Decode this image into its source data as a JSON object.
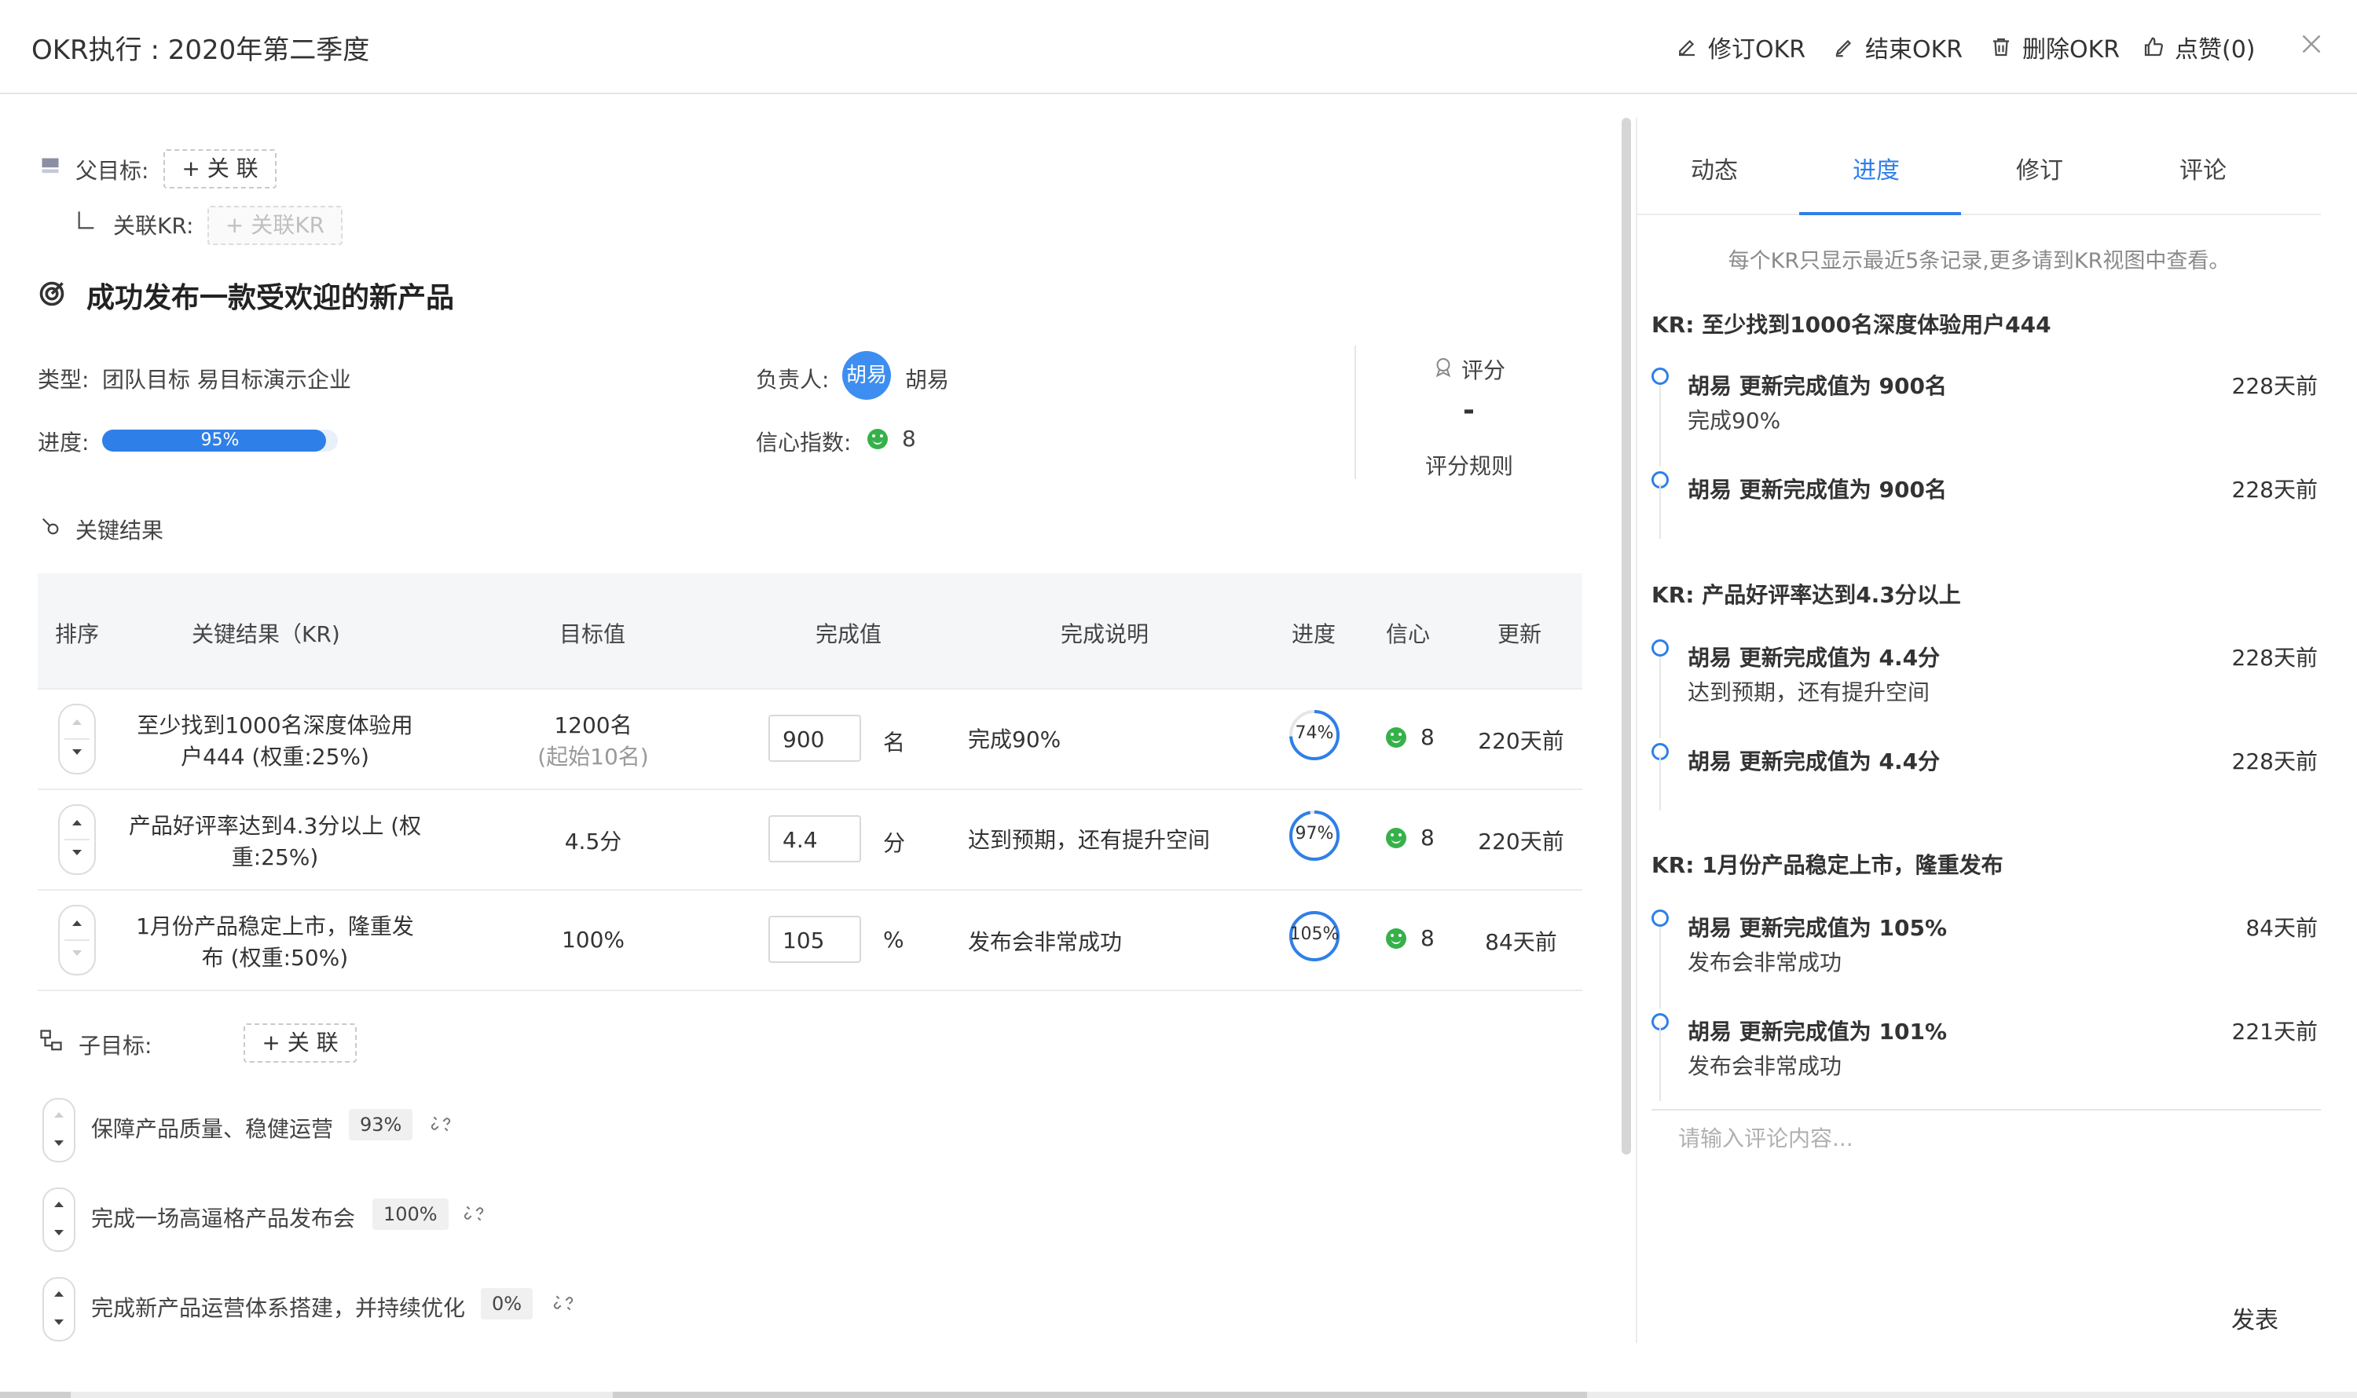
{
  "header": {
    "title": "OKR执行 : 2020年第二季度",
    "revise": "修订OKR",
    "finish": "结束OKR",
    "delete": "删除OKR",
    "like": "点赞(0)"
  },
  "parent": {
    "label": "父目标:",
    "link_btn": "+ 关 联",
    "kr_label": "关联KR:",
    "kr_btn": "+ 关联KR"
  },
  "objective": {
    "title": "成功发布一款受欢迎的新产品",
    "type_label": "类型:",
    "type_value": "团队目标 易目标演示企业",
    "owner_label": "负责人:",
    "owner_avatar": "胡易",
    "owner_name": "胡易",
    "progress_label": "进度:",
    "progress": 95,
    "progress_text": "95%",
    "confidence_label": "信心指数:",
    "confidence": "8",
    "score_title": "评分",
    "score_value": "-",
    "score_rule": "评分规则"
  },
  "kr_section": {
    "title": "关键结果",
    "headers": [
      "排序",
      "关键结果（KR)",
      "目标值",
      "完成值",
      "完成说明",
      "进度",
      "信心",
      "更新"
    ],
    "rows": [
      {
        "name1": "至少找到1000名深度体验用",
        "name2": "户444 (权重:25%)",
        "target": "1200名",
        "target_sub": "(起始10名)",
        "done": "900",
        "unit": "名",
        "desc": "完成90%",
        "progress": 74,
        "progress_text": "74%",
        "confidence": "8",
        "updated": "220天前"
      },
      {
        "name1": "产品好评率达到4.3分以上 (权",
        "name2": "重:25%)",
        "target": "4.5分",
        "target_sub": "",
        "done": "4.4",
        "unit": "分",
        "desc": "达到预期，还有提升空间",
        "progress": 97,
        "progress_text": "97%",
        "confidence": "8",
        "updated": "220天前"
      },
      {
        "name1": "1月份产品稳定上市，隆重发",
        "name2": "布 (权重:50%)",
        "target": "100%",
        "target_sub": "",
        "done": "105",
        "unit": "%",
        "desc": "发布会非常成功",
        "progress": 105,
        "progress_text": "105%",
        "confidence": "8",
        "updated": "84天前"
      }
    ]
  },
  "children": {
    "label": "子目标:",
    "link_btn": "+ 关 联",
    "items": [
      {
        "name": "保障产品质量、稳健运营",
        "badge": "93%"
      },
      {
        "name": "完成一场高逼格产品发布会",
        "badge": "100%"
      },
      {
        "name": "完成新产品运营体系搭建，并持续优化",
        "badge": "0%"
      }
    ]
  },
  "panel": {
    "tabs": [
      "动态",
      "进度",
      "修订",
      "评论"
    ],
    "hint": "每个KR只显示最近5条记录,更多请到KR视图中查看。",
    "groups": [
      {
        "title": "KR: 至少找到1000名深度体验用户444",
        "logs": [
          {
            "main": "胡易 更新完成值为 900名",
            "sub": "完成90%",
            "time": "228天前"
          },
          {
            "main": "胡易 更新完成值为 900名",
            "sub": "",
            "time": "228天前"
          }
        ]
      },
      {
        "title": "KR: 产品好评率达到4.3分以上",
        "logs": [
          {
            "main": "胡易 更新完成值为 4.4分",
            "sub": "达到预期，还有提升空间",
            "time": "228天前"
          },
          {
            "main": "胡易 更新完成值为 4.4分",
            "sub": "",
            "time": "228天前"
          }
        ]
      },
      {
        "title": "KR: 1月份产品稳定上市，隆重发布",
        "logs": [
          {
            "main": "胡易 更新完成值为 105%",
            "sub": "发布会非常成功",
            "time": "84天前"
          },
          {
            "main": "胡易 更新完成值为 101%",
            "sub": "发布会非常成功",
            "time": "221天前"
          }
        ]
      }
    ],
    "comment_placeholder": "请输入评论内容...",
    "publish": "发表"
  },
  "colors": {
    "accent": "#2f7fe8",
    "success": "#36b14a"
  }
}
